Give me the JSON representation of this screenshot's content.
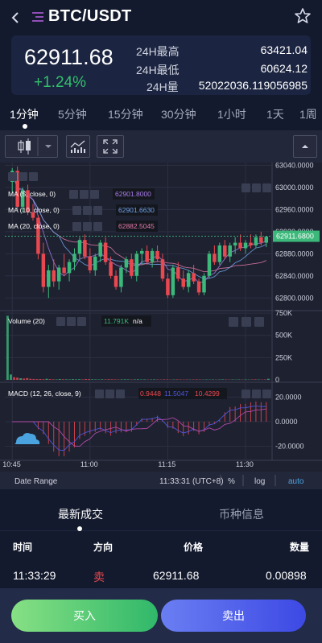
{
  "header": {
    "title": "BTC/USDT",
    "back_icon": "chevron-left-icon",
    "menu_icon": "menu-lines-icon",
    "favorite_icon": "star-outline-icon"
  },
  "ticker": {
    "last_price": "62911.68",
    "change_pct": "+1.24%",
    "high_label": "24H最高",
    "high_value": "63421.04",
    "low_label": "24H最低",
    "low_value": "60624.12",
    "volume_label": "24H量",
    "volume_value": "52022036.119056985"
  },
  "intervals": {
    "items": [
      "1分钟",
      "5分钟",
      "15分钟",
      "30分钟",
      "1小时",
      "1天",
      "1周"
    ],
    "active_index": 0
  },
  "chart_toolbar": {
    "chart_type_icon": "candlestick-icon",
    "dropdown_icon": "caret-down-icon",
    "indicators_icon": "indicators-icon",
    "fullscreen_icon": "fullscreen-icon",
    "collapse_icon": "caret-up-icon"
  },
  "chart_data": {
    "type": "candlestick",
    "price_axis": {
      "ticks": [
        "63040.0000",
        "63000.0000",
        "62960.0000",
        "62920.0000",
        "62880.0000",
        "62840.0000",
        "62800.0000"
      ],
      "ylim": [
        62780,
        63045
      ],
      "last_price_label": "62911.6800"
    },
    "time_axis": [
      "10:45",
      "11:00",
      "11:15",
      "11:30"
    ],
    "indicators": {
      "ma5": {
        "label": "MA (5, close, 0)",
        "value": "62901.8000",
        "color": "#a77ce8"
      },
      "ma10": {
        "label": "MA (10, close, 0)",
        "value": "62901.6630",
        "color": "#6fa3e8"
      },
      "ma20": {
        "label": "MA (20, close, 0)",
        "value": "62882.5045",
        "color": "#e07aa8"
      }
    },
    "volume": {
      "label": "Volume (20)",
      "value": "11.791K",
      "value2": "n/a",
      "ticks": [
        "750K",
        "500K",
        "250K",
        "0"
      ],
      "ylim": [
        0,
        760000
      ],
      "values": [
        720000,
        60000,
        30000,
        25000,
        18000,
        15000,
        20000,
        12000,
        10000,
        8000,
        9000,
        7000,
        12000,
        8000,
        6000,
        5000,
        9000,
        7000,
        6000,
        5000,
        8000,
        6000,
        7000,
        5000,
        9000,
        8000,
        6000,
        5000,
        4000,
        6000,
        5000,
        7000,
        6000,
        5000,
        4000,
        5000,
        6000,
        5000,
        4000,
        5000,
        6000,
        4000,
        5000,
        3000,
        4000,
        5000,
        4000,
        3000,
        5000,
        4000,
        3000,
        4000,
        5000,
        4000,
        3000,
        4000,
        3000,
        4000,
        5000,
        4000,
        3000,
        4000,
        3000,
        4000,
        3000,
        4000,
        5000,
        4000,
        3000,
        4000,
        3000,
        4000,
        3000,
        4000,
        3000,
        4000,
        5000,
        4000,
        3000,
        4000,
        12000
      ]
    },
    "macd": {
      "label": "MACD (12, 26, close, 9)",
      "value1": "0.9448",
      "value2": "11.5047",
      "value3": "10.4299",
      "ticks": [
        "20.0000",
        "0.0000",
        "-20.0000"
      ],
      "ylim": [
        -30,
        30
      ]
    },
    "candles": [
      [
        63010,
        63035,
        62990,
        63030
      ],
      [
        63030,
        63038,
        62960,
        62965
      ],
      [
        62965,
        63000,
        62955,
        62995
      ],
      [
        62995,
        63005,
        62950,
        62955
      ],
      [
        62955,
        62970,
        62940,
        62945
      ],
      [
        62945,
        62950,
        62870,
        62880
      ],
      [
        62880,
        62900,
        62810,
        62820
      ],
      [
        62820,
        62860,
        62800,
        62850
      ],
      [
        62850,
        62870,
        62820,
        62830
      ],
      [
        62830,
        62860,
        62815,
        62855
      ],
      [
        62855,
        62880,
        62840,
        62845
      ],
      [
        62845,
        62870,
        62830,
        62865
      ],
      [
        62865,
        62890,
        62850,
        62880
      ],
      [
        62880,
        62910,
        62870,
        62905
      ],
      [
        62905,
        62915,
        62870,
        62875
      ],
      [
        62875,
        62890,
        62845,
        62850
      ],
      [
        62850,
        62880,
        62840,
        62875
      ],
      [
        62875,
        62905,
        62865,
        62900
      ],
      [
        62900,
        62910,
        62860,
        62865
      ],
      [
        62865,
        62875,
        62835,
        62840
      ],
      [
        62840,
        62850,
        62815,
        62820
      ],
      [
        62820,
        62860,
        62810,
        62855
      ],
      [
        62855,
        62875,
        62845,
        62870
      ],
      [
        62870,
        62880,
        62835,
        62840
      ],
      [
        62840,
        62885,
        62830,
        62880
      ],
      [
        62880,
        62890,
        62860,
        62885
      ],
      [
        62885,
        62895,
        62860,
        62865
      ],
      [
        62865,
        62890,
        62855,
        62885
      ],
      [
        62885,
        62895,
        62865,
        62870
      ],
      [
        62870,
        62880,
        62830,
        62835
      ],
      [
        62835,
        62845,
        62800,
        62805
      ],
      [
        62805,
        62860,
        62800,
        62855
      ],
      [
        62855,
        62865,
        62830,
        62835
      ],
      [
        62835,
        62850,
        62815,
        62820
      ],
      [
        62820,
        62850,
        62810,
        62845
      ],
      [
        62845,
        62860,
        62825,
        62830
      ],
      [
        62830,
        62835,
        62805,
        62810
      ],
      [
        62810,
        62845,
        62805,
        62840
      ],
      [
        62840,
        62885,
        62835,
        62880
      ],
      [
        62880,
        62895,
        62860,
        62865
      ],
      [
        62865,
        62900,
        62860,
        62895
      ],
      [
        62895,
        62905,
        62870,
        62875
      ],
      [
        62875,
        62900,
        62865,
        62895
      ],
      [
        62895,
        62910,
        62880,
        62900
      ],
      [
        62900,
        62915,
        62885,
        62890
      ],
      [
        62890,
        62905,
        62880,
        62900
      ],
      [
        62900,
        62915,
        62890,
        62895
      ],
      [
        62895,
        62915,
        62890,
        62910
      ],
      [
        62910,
        62920,
        62895,
        62900
      ],
      [
        62900,
        62912,
        62892,
        62911
      ]
    ],
    "footer": {
      "date_range": "Date Range",
      "time": "11:33:31 (UTC+8)",
      "pct": "%",
      "log": "log",
      "auto": "auto"
    }
  },
  "info_tabs": {
    "items": [
      "最新成交",
      "币种信息"
    ],
    "active_index": 0
  },
  "trades": {
    "headers": [
      "时间",
      "方向",
      "价格",
      "数量"
    ],
    "rows": [
      {
        "time": "11:33:29",
        "side": "卖",
        "price": "62911.68",
        "qty": "0.00898"
      }
    ]
  },
  "actions": {
    "buy": "买入",
    "sell": "卖出"
  },
  "colors": {
    "up": "#3bb87a",
    "down": "#e8484f",
    "accent": "#4aa3df",
    "background": "#131a2e"
  }
}
